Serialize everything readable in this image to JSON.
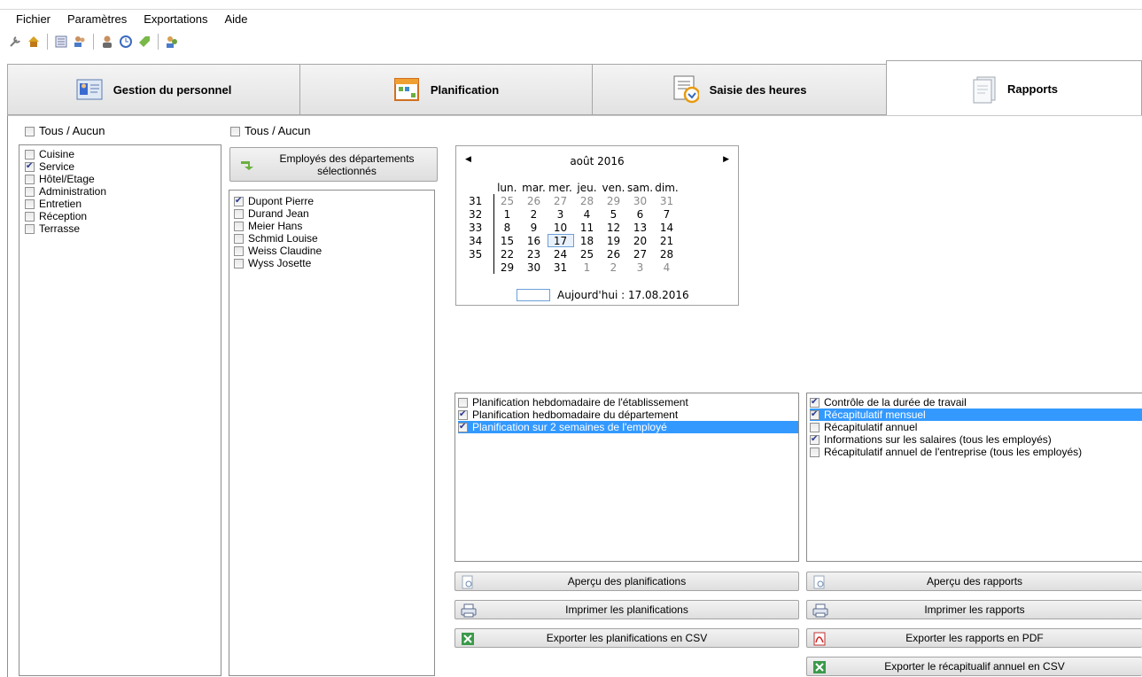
{
  "menu": [
    "Fichier",
    "Paramètres",
    "Exportations",
    "Aide"
  ],
  "toolbar_icons": [
    "wrench-icon",
    "home-icon",
    "list-icon",
    "users-icon",
    "sep",
    "person-icon",
    "clock-icon",
    "tag-icon",
    "sep",
    "group-icon"
  ],
  "tabs": [
    {
      "label": "Gestion du personnel",
      "icon": "staff-card-icon"
    },
    {
      "label": "Planification",
      "icon": "planning-grid-icon"
    },
    {
      "label": "Saisie des heures",
      "icon": "time-entry-icon"
    },
    {
      "label": "Rapports",
      "icon": "reports-icon"
    }
  ],
  "departments": {
    "all_label": "Tous / Aucun",
    "items": [
      {
        "label": "Cuisine",
        "checked": false
      },
      {
        "label": "Service",
        "checked": true
      },
      {
        "label": "Hôtel/Etage",
        "checked": false
      },
      {
        "label": "Administration",
        "checked": false
      },
      {
        "label": "Entretien",
        "checked": false
      },
      {
        "label": "Réception",
        "checked": false
      },
      {
        "label": "Terrasse",
        "checked": false
      }
    ]
  },
  "employees": {
    "all_label": "Tous / Aucun",
    "button_line1": "Employés des départements",
    "button_line2": "sélectionnés",
    "items": [
      {
        "label": "Dupont Pierre",
        "checked": true
      },
      {
        "label": "Durand Jean",
        "checked": false
      },
      {
        "label": "Meier Hans",
        "checked": false
      },
      {
        "label": "Schmid Louise",
        "checked": false
      },
      {
        "label": "Weiss Claudine",
        "checked": false
      },
      {
        "label": "Wyss Josette",
        "checked": false
      }
    ]
  },
  "calendar": {
    "month_label": "août 2016",
    "weekdays": [
      "lun.",
      "mar.",
      "mer.",
      "jeu.",
      "ven.",
      "sam.",
      "dim."
    ],
    "weeks": [
      {
        "wk": "31",
        "days": [
          "25",
          "26",
          "27",
          "28",
          "29",
          "30",
          "31"
        ]
      },
      {
        "wk": "32",
        "days": [
          "1",
          "2",
          "3",
          "4",
          "5",
          "6",
          "7"
        ]
      },
      {
        "wk": "33",
        "days": [
          "8",
          "9",
          "10",
          "11",
          "12",
          "13",
          "14"
        ]
      },
      {
        "wk": "34",
        "days": [
          "15",
          "16",
          "17",
          "18",
          "19",
          "20",
          "21"
        ]
      },
      {
        "wk": "35",
        "days": [
          "22",
          "23",
          "24",
          "25",
          "26",
          "27",
          "28"
        ]
      },
      {
        "wk": "",
        "days": [
          "29",
          "30",
          "31",
          "1",
          "2",
          "3",
          "4"
        ]
      }
    ],
    "today_label": "Aujourd'hui : 17.08.2016"
  },
  "plannings": {
    "items": [
      {
        "label": "Planification hebdomadaire de l'établissement",
        "checked": false,
        "selected": false
      },
      {
        "label": "Planification hedbomadaire du département",
        "checked": true,
        "selected": false
      },
      {
        "label": "Planification sur 2 semaines de l'employé",
        "checked": true,
        "selected": true
      }
    ]
  },
  "reports": {
    "items": [
      {
        "label": "Contrôle de la durée de travail",
        "checked": true,
        "selected": false
      },
      {
        "label": "Récapitulatif mensuel",
        "checked": true,
        "selected": true
      },
      {
        "label": "Récapitulatif annuel",
        "checked": false,
        "selected": false
      },
      {
        "label": "Informations sur les salaires (tous les employés)",
        "checked": true,
        "selected": false
      },
      {
        "label": "Récapitulatif annuel de l'entreprise (tous les employés)",
        "checked": false,
        "selected": false
      }
    ]
  },
  "buttons": {
    "preview_plannings": "Aperçu des planifications",
    "print_plannings": "Imprimer les planifications",
    "export_plannings_csv": "Exporter les planifications en CSV",
    "preview_reports": "Aperçu des rapports",
    "print_reports": "Imprimer les rapports",
    "export_reports_pdf": "Exporter les rapports en PDF",
    "export_annual_csv": "Exporter le récapitualif annuel en CSV"
  }
}
